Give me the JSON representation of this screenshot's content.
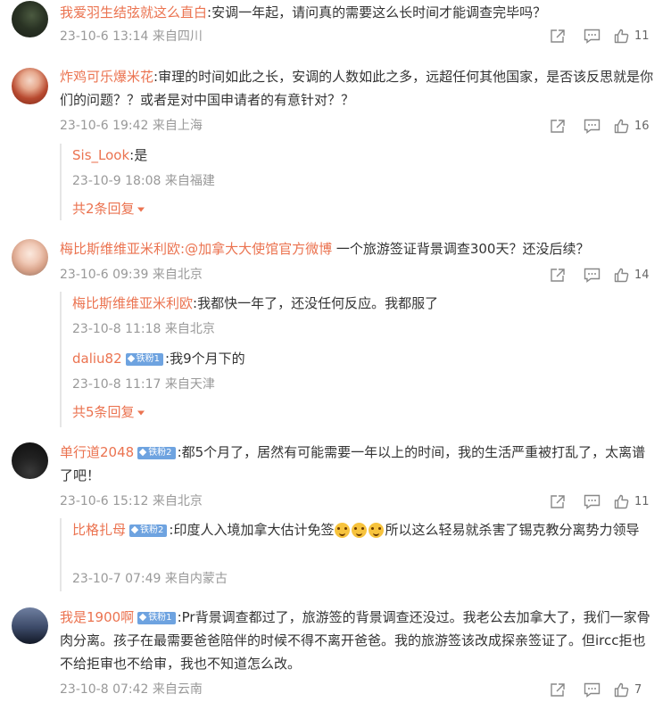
{
  "comments": [
    {
      "user": "我爱羽生结弦就这么直白",
      "text": ":安调一年起，请问真的需要这么长时间才能调查完毕吗？",
      "time": "23-10-6 13:14 来自四川",
      "likes": "11"
    },
    {
      "user": "炸鸡可乐爆米花",
      "text": ":审理的时间如此之长，安调的人数如此之多，远超任何其他国家，是否该反思就是你们的问题？？或者是对中国申请者的有意针对？？",
      "time": "23-10-6 19:42 来自上海",
      "likes": "16",
      "replies": [
        {
          "user": "Sis_Look",
          "text": ":是",
          "time": "23-10-9 18:08 来自福建"
        }
      ],
      "more": "共2条回复"
    },
    {
      "user": "梅比斯维维亚米利欧",
      "mention": ":@加拿大大使馆官方微博",
      "text": " 一个旅游签证背景调查300天？还没后续？",
      "time": "23-10-6 09:39 来自北京",
      "likes": "14",
      "replies": [
        {
          "user": "梅比斯维维亚米利欧",
          "text": ":我都快一年了，还没任何反应。我都服了",
          "time": "23-10-8 11:18 来自北京"
        },
        {
          "user": "daliu82",
          "badge": "铁粉1",
          "text": ":我9个月下的",
          "time": "23-10-8 11:17 来自天津"
        }
      ],
      "more": "共5条回复"
    },
    {
      "user": "单行道2048",
      "badge": "铁粉2",
      "text": ":都5个月了，居然有可能需要一年以上的时间，我的生活严重被打乱了，太离谱了吧！",
      "time": "23-10-6 15:12 来自北京",
      "likes": "11",
      "replies": [
        {
          "user": "比格扎母",
          "badge": "铁粉2",
          "text_a": ":印度人入境加拿大估计免签",
          "text_b": "所以这么轻易就杀害了锡克教分离势力领导",
          "time": "23-10-7 07:49 来自内蒙古"
        }
      ]
    },
    {
      "user": "我是1900啊",
      "badge": "铁粉1",
      "text": ":Pr背景调查都过了，旅游签的背景调查还没过。我老公去加拿大了，我们一家骨肉分离。孩子在最需要爸爸陪伴的时候不得不离开爸爸。我的旅游签该改成探亲签证了。但ircc拒也不给拒审也不给审，我也不知道怎么改。",
      "time": "23-10-8 07:42 来自云南",
      "likes": "7"
    }
  ],
  "colors": {
    "username": "#eb7350",
    "meta": "#999999",
    "badge": "#6ea3e0"
  },
  "icons": [
    "share-icon",
    "comment-icon",
    "like-icon",
    "chevron-down-icon",
    "emoji-doge-icon"
  ]
}
